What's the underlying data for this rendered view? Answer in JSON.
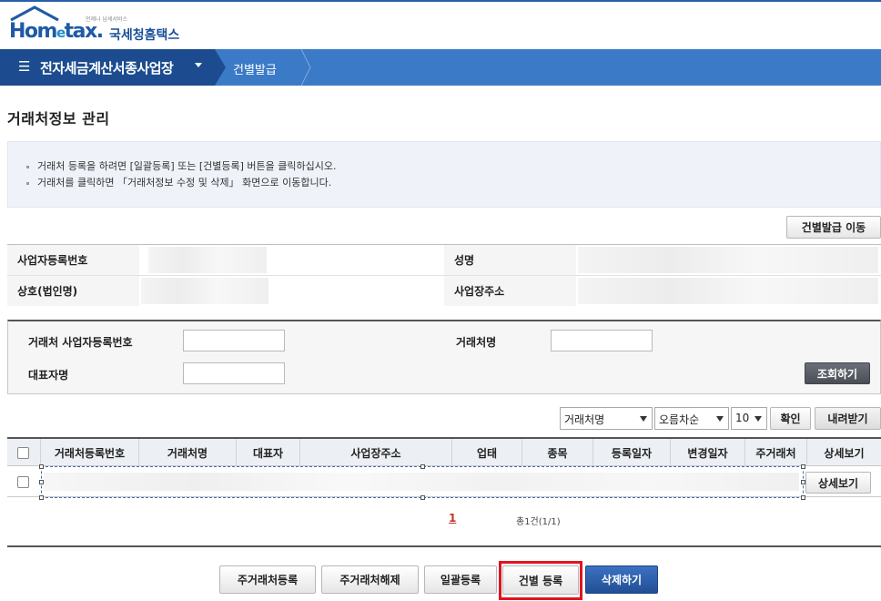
{
  "logo": {
    "tagline": "언제나 납세서비스",
    "wordmark_ho": "Hom",
    "wordmark_e": "e",
    "wordmark_tax": "tax.",
    "service_name": "국세청홈택스",
    "color": "#1f5aa5"
  },
  "breadcrumb": {
    "menu_icon": "☰",
    "main": "전자세금계산서종사업장",
    "sub": "건별발급"
  },
  "page": {
    "title": "거래처정보 관리"
  },
  "notice": {
    "lines": [
      "거래처 등록을 하려면 [일괄등록] 또는 [건별등록] 버튼을 클릭하십시오.",
      "거래처를 클릭하면 「거래처정보 수정 및 삭제」 화면으로 이동합니다."
    ]
  },
  "actions": {
    "go_individual_issue": "건별발급 이동"
  },
  "info": {
    "biz_no_label": "사업자등록번호",
    "name_label": "성명",
    "company_label": "상호(법인명)",
    "address_label": "사업장주소"
  },
  "search": {
    "partner_biz_no_label": "거래처 사업자등록번호",
    "partner_name_label": "거래처명",
    "rep_name_label": "대표자명",
    "partner_biz_no_value": "",
    "partner_name_value": "",
    "rep_name_value": "",
    "search_button": "조회하기"
  },
  "list_controls": {
    "sort_field": "거래처명",
    "sort_order": "오름차순",
    "page_size": "10",
    "confirm_button": "확인",
    "download_button": "내려받기"
  },
  "grid": {
    "columns": [
      "거래처등록번호",
      "거래처명",
      "대표자",
      "사업장주소",
      "업태",
      "종목",
      "등록일자",
      "변경일자",
      "주거래처",
      "상세보기"
    ],
    "row_detail_button": "상세보기"
  },
  "pager": {
    "current": "1",
    "total": "총1건(1/1)"
  },
  "bottom_buttons": {
    "main_partner_register": "주거래처등록",
    "main_partner_release": "주거래처해제",
    "bulk_register": "일괄등록",
    "single_register": "건별 등록",
    "delete": "삭제하기"
  },
  "colors": {
    "nav_dark": "#1c4c8f",
    "nav_light": "#3b7ac7",
    "highlight": "#e0151e",
    "primary_button": "#234f94"
  }
}
